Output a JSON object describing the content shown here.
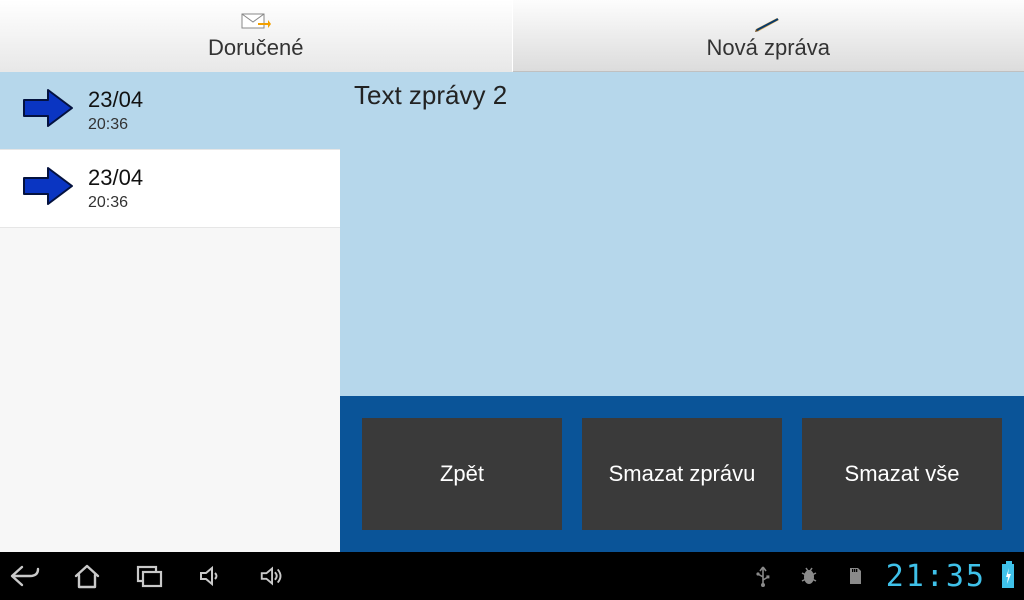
{
  "tabs": {
    "inbox_label": "Doručené",
    "compose_label": "Nová zpráva"
  },
  "messages": [
    {
      "date": "23/04",
      "time": "20:36"
    },
    {
      "date": "23/04",
      "time": "20:36"
    }
  ],
  "detail": {
    "title": "Text zprávy 2"
  },
  "actions": {
    "back": "Zpět",
    "delete_msg": "Smazat zprávu",
    "delete_all": "Smazat vše"
  },
  "status": {
    "clock": "21:35"
  }
}
